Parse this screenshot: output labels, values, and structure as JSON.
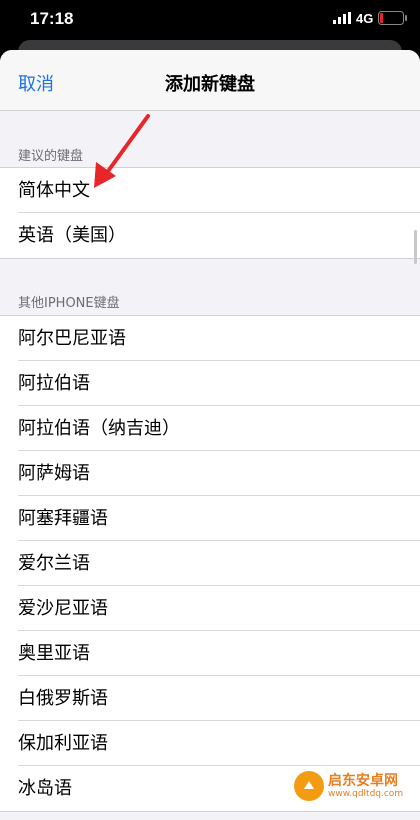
{
  "status_bar": {
    "time": "17:18",
    "network": "4G"
  },
  "nav": {
    "cancel_label": "取消",
    "title": "添加新键盘"
  },
  "suggested": {
    "header": "建议的键盘",
    "items": [
      "简体中文",
      "英语（美国）"
    ]
  },
  "other": {
    "header": "其他IPHONE键盘",
    "items": [
      "阿尔巴尼亚语",
      "阿拉伯语",
      "阿拉伯语（纳吉迪）",
      "阿萨姆语",
      "阿塞拜疆语",
      "爱尔兰语",
      "爱沙尼亚语",
      "奥里亚语",
      "白俄罗斯语",
      "保加利亚语",
      "冰岛语"
    ]
  },
  "watermark": {
    "title": "启东安卓网",
    "url": "www.qdltdq.com"
  },
  "colors": {
    "accent": "#1a73e8",
    "annotation_arrow": "#e8262a",
    "watermark": "#e67e22"
  }
}
